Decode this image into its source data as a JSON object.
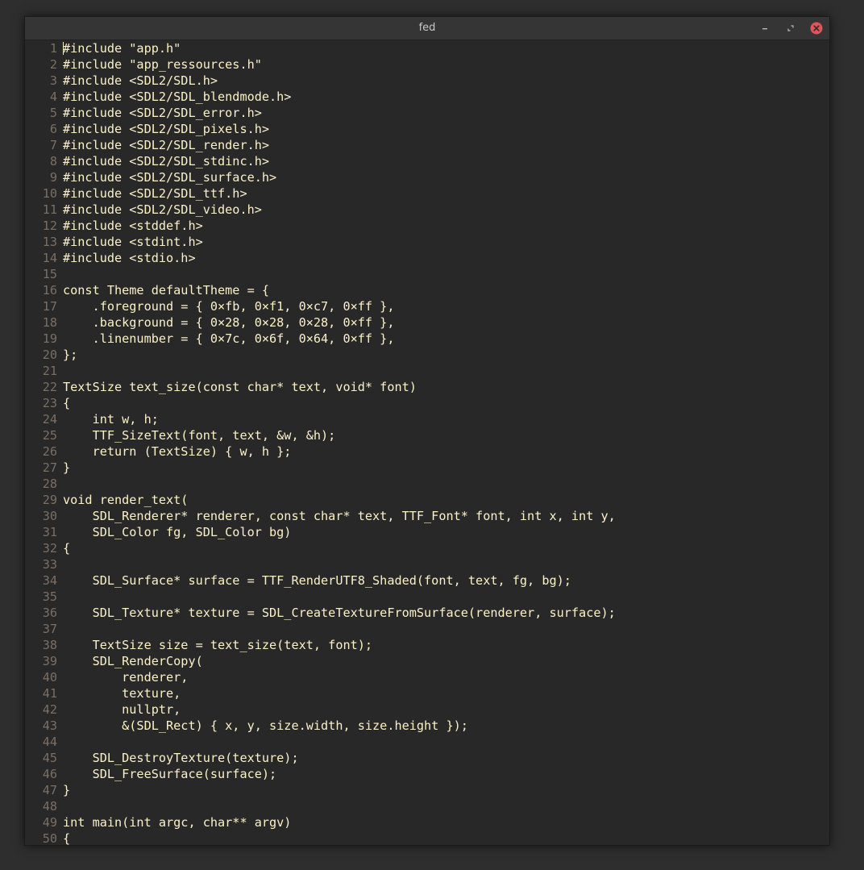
{
  "window": {
    "title": "fed",
    "controls": {
      "minimize_icon": "minimize-icon",
      "maximize_icon": "maximize-icon",
      "close_icon": "close-icon"
    }
  },
  "theme": {
    "foreground": "#fbf1c7",
    "background": "#282828",
    "linenumber": "#7c6f64",
    "close_button": "#e0555a"
  },
  "editor": {
    "lines": [
      {
        "n": "1",
        "text": "#include \"app.h\""
      },
      {
        "n": "2",
        "text": "#include \"app_ressources.h\""
      },
      {
        "n": "3",
        "text": "#include <SDL2/SDL.h>"
      },
      {
        "n": "4",
        "text": "#include <SDL2/SDL_blendmode.h>"
      },
      {
        "n": "5",
        "text": "#include <SDL2/SDL_error.h>"
      },
      {
        "n": "6",
        "text": "#include <SDL2/SDL_pixels.h>"
      },
      {
        "n": "7",
        "text": "#include <SDL2/SDL_render.h>"
      },
      {
        "n": "8",
        "text": "#include <SDL2/SDL_stdinc.h>"
      },
      {
        "n": "9",
        "text": "#include <SDL2/SDL_surface.h>"
      },
      {
        "n": "10",
        "text": "#include <SDL2/SDL_ttf.h>"
      },
      {
        "n": "11",
        "text": "#include <SDL2/SDL_video.h>"
      },
      {
        "n": "12",
        "text": "#include <stddef.h>"
      },
      {
        "n": "13",
        "text": "#include <stdint.h>"
      },
      {
        "n": "14",
        "text": "#include <stdio.h>"
      },
      {
        "n": "15",
        "text": ""
      },
      {
        "n": "16",
        "text": "const Theme defaultTheme = {"
      },
      {
        "n": "17",
        "text": "    .foreground = { 0×fb, 0×f1, 0×c7, 0×ff },"
      },
      {
        "n": "18",
        "text": "    .background = { 0×28, 0×28, 0×28, 0×ff },"
      },
      {
        "n": "19",
        "text": "    .linenumber = { 0×7c, 0×6f, 0×64, 0×ff },"
      },
      {
        "n": "20",
        "text": "};"
      },
      {
        "n": "21",
        "text": ""
      },
      {
        "n": "22",
        "text": "TextSize text_size(const char* text, void* font)"
      },
      {
        "n": "23",
        "text": "{"
      },
      {
        "n": "24",
        "text": "    int w, h;"
      },
      {
        "n": "25",
        "text": "    TTF_SizeText(font, text, &w, &h);"
      },
      {
        "n": "26",
        "text": "    return (TextSize) { w, h };"
      },
      {
        "n": "27",
        "text": "}"
      },
      {
        "n": "28",
        "text": ""
      },
      {
        "n": "29",
        "text": "void render_text("
      },
      {
        "n": "30",
        "text": "    SDL_Renderer* renderer, const char* text, TTF_Font* font, int x, int y,"
      },
      {
        "n": "31",
        "text": "    SDL_Color fg, SDL_Color bg)"
      },
      {
        "n": "32",
        "text": "{"
      },
      {
        "n": "33",
        "text": ""
      },
      {
        "n": "34",
        "text": "    SDL_Surface* surface = TTF_RenderUTF8_Shaded(font, text, fg, bg);"
      },
      {
        "n": "35",
        "text": ""
      },
      {
        "n": "36",
        "text": "    SDL_Texture* texture = SDL_CreateTextureFromSurface(renderer, surface);"
      },
      {
        "n": "37",
        "text": ""
      },
      {
        "n": "38",
        "text": "    TextSize size = text_size(text, font);"
      },
      {
        "n": "39",
        "text": "    SDL_RenderCopy("
      },
      {
        "n": "40",
        "text": "        renderer,"
      },
      {
        "n": "41",
        "text": "        texture,"
      },
      {
        "n": "42",
        "text": "        nullptr,"
      },
      {
        "n": "43",
        "text": "        &(SDL_Rect) { x, y, size.width, size.height });"
      },
      {
        "n": "44",
        "text": ""
      },
      {
        "n": "45",
        "text": "    SDL_DestroyTexture(texture);"
      },
      {
        "n": "46",
        "text": "    SDL_FreeSurface(surface);"
      },
      {
        "n": "47",
        "text": "}"
      },
      {
        "n": "48",
        "text": ""
      },
      {
        "n": "49",
        "text": "int main(int argc, char** argv)"
      },
      {
        "n": "50",
        "text": "{"
      }
    ]
  }
}
